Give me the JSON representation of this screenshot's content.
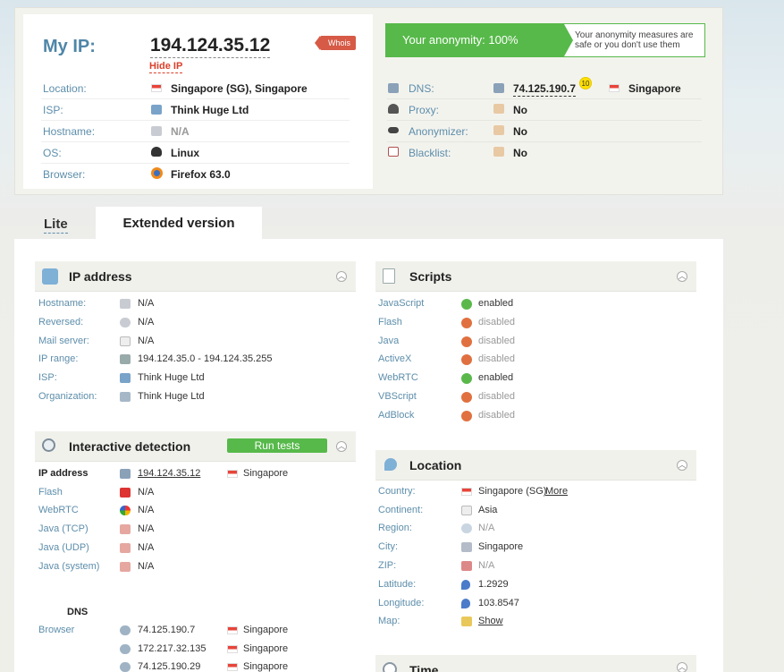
{
  "myip": {
    "label": "My IP:",
    "value": "194.124.35.12",
    "hide": "Hide IP",
    "whois": "Whois"
  },
  "info": [
    {
      "label": "Location:",
      "value": "Singapore (SG), Singapore",
      "icon": "flag-sg-icon"
    },
    {
      "label": "ISP:",
      "value": "Think Huge Ltd",
      "icon": "isp-icon"
    },
    {
      "label": "Hostname:",
      "value": "N/A",
      "icon": "server-icon"
    },
    {
      "label": "OS:",
      "value": "Linux",
      "icon": "linux-icon"
    },
    {
      "label": "Browser:",
      "value": "Firefox 63.0",
      "icon": "firefox-icon"
    }
  ],
  "anonymity": {
    "label": "Your anonymity: 100%",
    "note": "Your anonymity measures are safe or you don't use them",
    "color": "#57b94a"
  },
  "checks": [
    {
      "label": "DNS:",
      "value": "74.125.190.7",
      "badge": "10",
      "country": "Singapore"
    },
    {
      "label": "Proxy:",
      "value": "No"
    },
    {
      "label": "Anonymizer:",
      "value": "No"
    },
    {
      "label": "Blacklist:",
      "value": "No"
    }
  ],
  "tabs": {
    "lite": "Lite",
    "extended": "Extended version"
  },
  "ip_section": {
    "title": "IP address",
    "rows": [
      {
        "k": "Hostname:",
        "v": "N/A"
      },
      {
        "k": "Reversed:",
        "v": "N/A"
      },
      {
        "k": "Mail server:",
        "v": "N/A"
      },
      {
        "k": "IP range:",
        "v": "194.124.35.0 - 194.124.35.255"
      },
      {
        "k": "ISP:",
        "v": "Think Huge Ltd"
      },
      {
        "k": "Organization:",
        "v": "Think Huge Ltd"
      }
    ]
  },
  "interactive": {
    "title": "Interactive detection",
    "run": "Run tests",
    "ip_label": "IP address",
    "ip_value": "194.124.35.12",
    "ip_country": "Singapore",
    "rows": [
      {
        "k": "Flash",
        "v": "N/A"
      },
      {
        "k": "WebRTC",
        "v": "N/A"
      },
      {
        "k": "Java (TCP)",
        "v": "N/A"
      },
      {
        "k": "Java (UDP)",
        "v": "N/A"
      },
      {
        "k": "Java (system)",
        "v": "N/A"
      }
    ],
    "dns_title": "DNS",
    "dns_label": "Browser",
    "dns": [
      {
        "ip": "74.125.190.7",
        "country": "Singapore"
      },
      {
        "ip": "172.217.32.135",
        "country": "Singapore"
      },
      {
        "ip": "74.125.190.29",
        "country": "Singapore"
      }
    ]
  },
  "scripts": {
    "title": "Scripts",
    "rows": [
      {
        "k": "JavaScript",
        "v": "enabled",
        "on": true
      },
      {
        "k": "Flash",
        "v": "disabled",
        "on": false
      },
      {
        "k": "Java",
        "v": "disabled",
        "on": false
      },
      {
        "k": "ActiveX",
        "v": "disabled",
        "on": false
      },
      {
        "k": "WebRTC",
        "v": "enabled",
        "on": true
      },
      {
        "k": "VBScript",
        "v": "disabled",
        "on": false
      },
      {
        "k": "AdBlock",
        "v": "disabled",
        "on": false
      }
    ]
  },
  "location": {
    "title": "Location",
    "rows": [
      {
        "k": "Country:",
        "v": "Singapore (SG)",
        "link": "More"
      },
      {
        "k": "Continent:",
        "v": "Asia"
      },
      {
        "k": "Region:",
        "v": "N/A"
      },
      {
        "k": "City:",
        "v": "Singapore"
      },
      {
        "k": "ZIP:",
        "v": "N/A"
      },
      {
        "k": "Latitude:",
        "v": "1.2929"
      },
      {
        "k": "Longitude:",
        "v": "103.8547"
      },
      {
        "k": "Map:",
        "v": "Show"
      }
    ]
  },
  "time": {
    "title": "Time"
  },
  "colors": {
    "accent": "#5d8eab",
    "green": "#57b94a",
    "red": "#d9412b"
  }
}
